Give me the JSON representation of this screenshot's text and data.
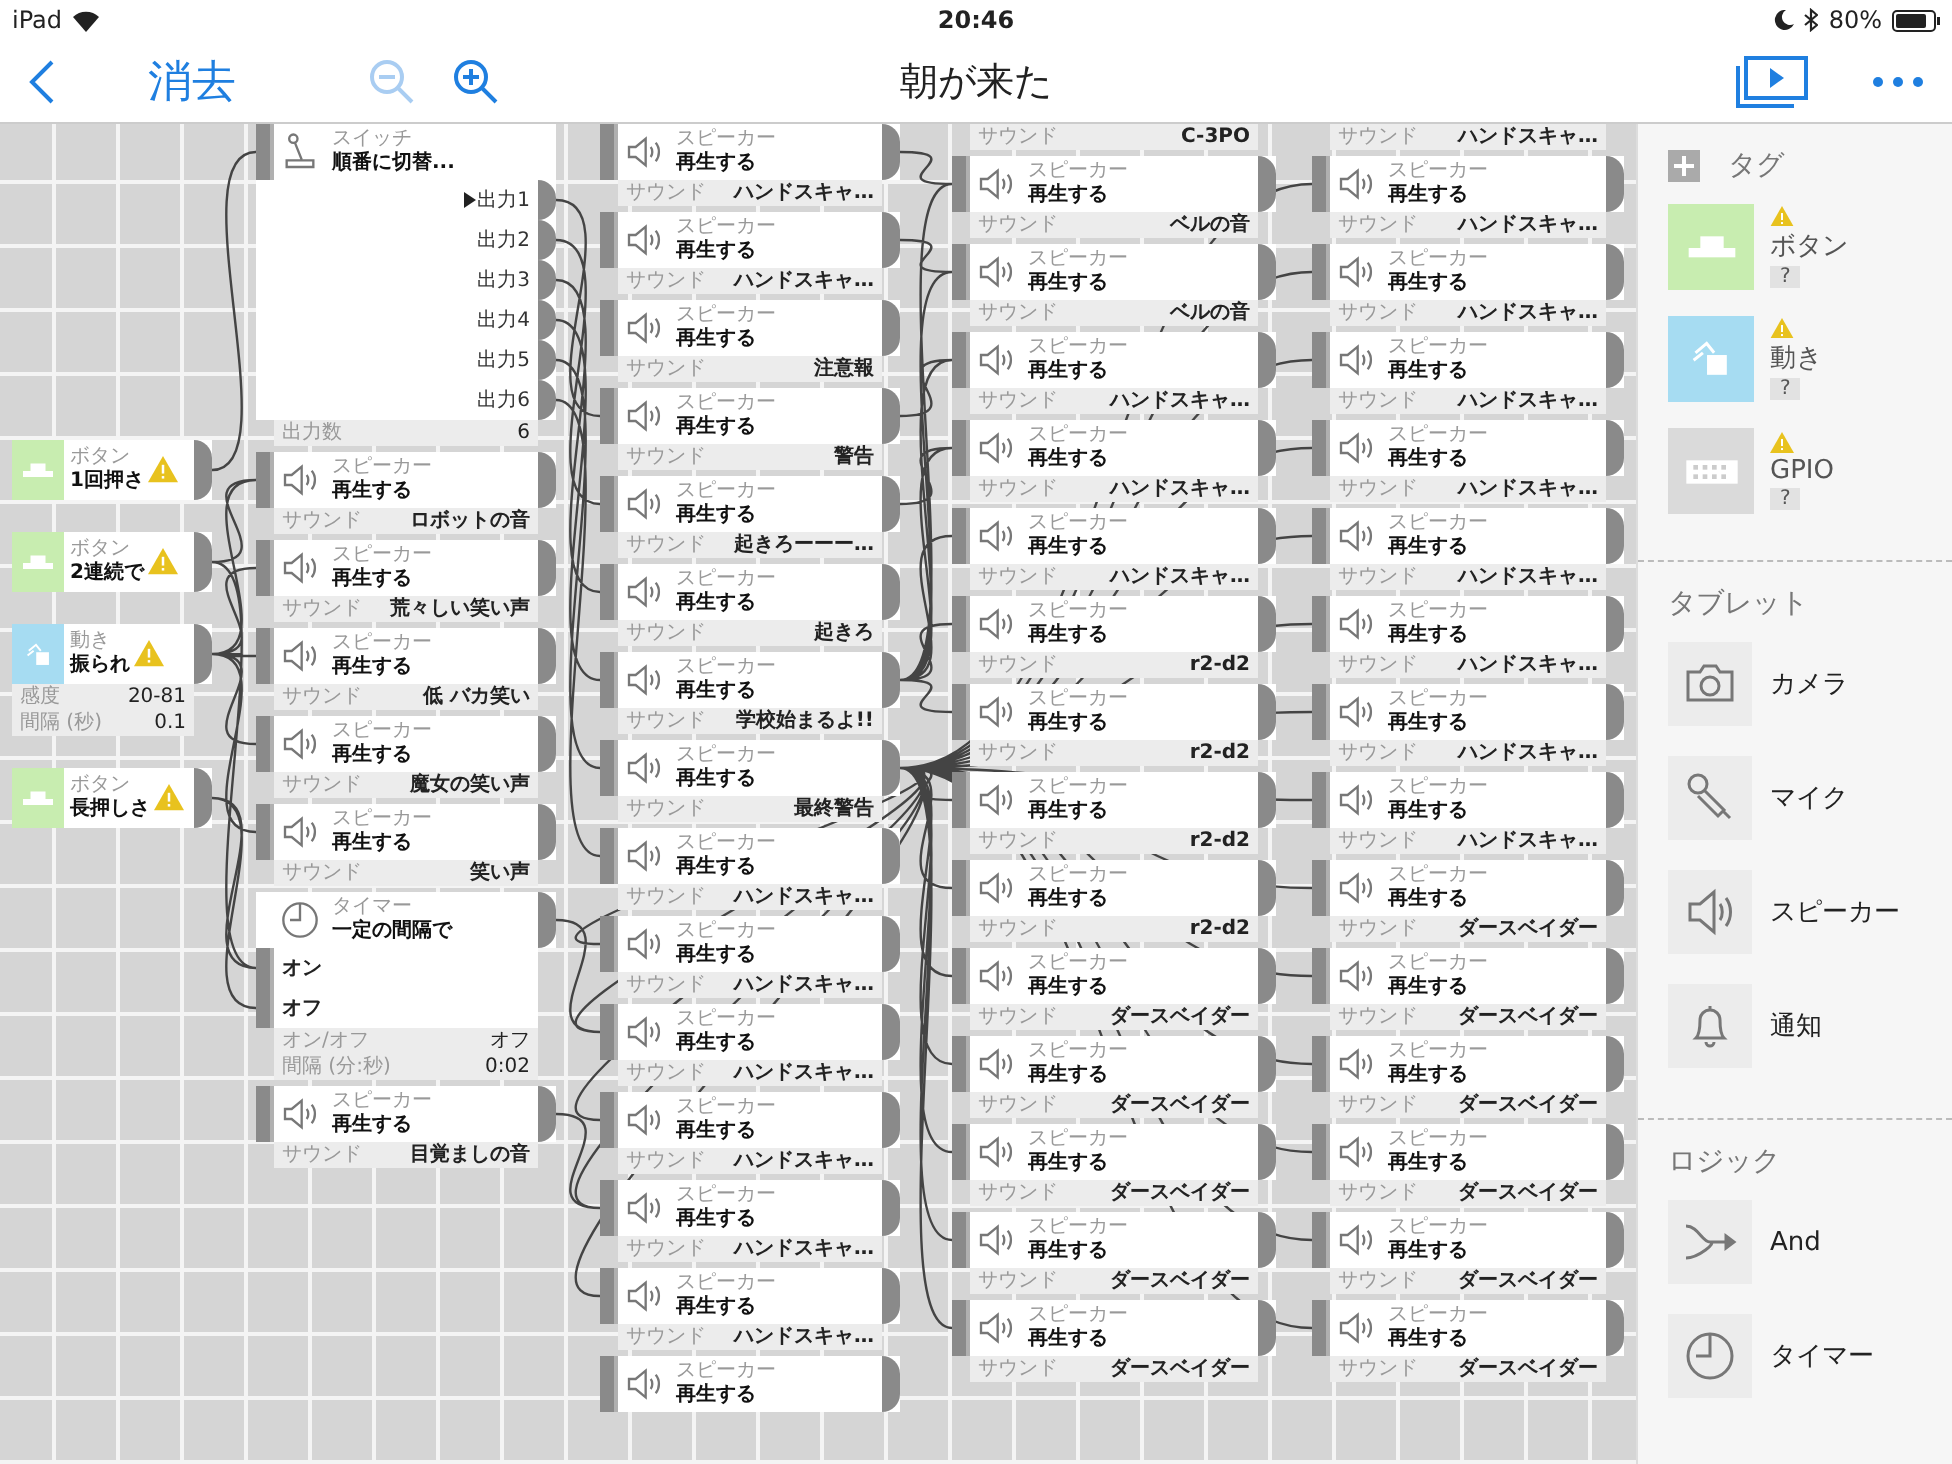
{
  "status_bar": {
    "device": "iPad",
    "time": "20:46",
    "battery": "80%"
  },
  "toolbar": {
    "clear": "消去",
    "title": "朝が来た",
    "zoom_out": {
      "disabled": true
    },
    "zoom_in": {
      "disabled": false
    }
  },
  "canvas": {
    "tag_nodes": [
      {
        "kind": "button",
        "color": "#c8edb0",
        "label": "ボタン",
        "title": "1回押さ",
        "warning": true
      },
      {
        "kind": "button",
        "color": "#c8edb0",
        "label": "ボタン",
        "title": "2連続で",
        "warning": true
      },
      {
        "kind": "motion",
        "color": "#a6dcf2",
        "label": "動き",
        "title": "振られ",
        "warning": true,
        "settings": [
          {
            "name": "感度",
            "value": "20-81"
          },
          {
            "name": "間隔 (秒)",
            "value": "0.1"
          }
        ]
      },
      {
        "kind": "button",
        "color": "#c8edb0",
        "label": "ボタン",
        "title": "長押しさ",
        "warning": true
      }
    ],
    "node_columns": [
      {
        "nodes": [
          {
            "kind": "switch",
            "label": "スイッチ",
            "title": "順番に切替...",
            "outputs": [
              {
                "label": "出力1",
                "selected": true
              },
              {
                "label": "出力2",
                "selected": false
              },
              {
                "label": "出力3",
                "selected": false
              },
              {
                "label": "出力4",
                "selected": false
              },
              {
                "label": "出力5",
                "selected": false
              },
              {
                "label": "出力6",
                "selected": false
              }
            ],
            "footer": [
              {
                "name": "出力数",
                "value": "6"
              }
            ]
          },
          {
            "kind": "speaker",
            "label": "スピーカー",
            "action": "再生する",
            "sound_label": "サウンド",
            "sound": "ロボットの音"
          },
          {
            "kind": "speaker",
            "label": "スピーカー",
            "action": "再生する",
            "sound_label": "サウンド",
            "sound": "荒々しい笑い声"
          },
          {
            "kind": "speaker",
            "label": "スピーカー",
            "action": "再生する",
            "sound_label": "サウンド",
            "sound": "低 バカ笑い"
          },
          {
            "kind": "speaker",
            "label": "スピーカー",
            "action": "再生する",
            "sound_label": "サウンド",
            "sound": "魔女の笑い声"
          },
          {
            "kind": "speaker",
            "label": "スピーカー",
            "action": "再生する",
            "sound_label": "サウンド",
            "sound": "笑い声"
          },
          {
            "kind": "timer",
            "label": "タイマー",
            "title": "一定の間隔で",
            "inputs": [
              "オン",
              "オフ"
            ],
            "footer": [
              {
                "name": "オン/オフ",
                "value": "オフ"
              },
              {
                "name": "間隔 (分:秒)",
                "value": "0:02"
              }
            ]
          },
          {
            "kind": "speaker",
            "label": "スピーカー",
            "action": "再生する",
            "sound_label": "サウンド",
            "sound": "目覚ましの音"
          }
        ]
      },
      {
        "nodes": [
          {
            "kind": "speaker",
            "label": "スピーカー",
            "action": "再生する",
            "sound_label": "サウンド",
            "sound": "ハンドスキャ…"
          },
          {
            "kind": "speaker",
            "label": "スピーカー",
            "action": "再生する",
            "sound_label": "サウンド",
            "sound": "ハンドスキャ…"
          },
          {
            "kind": "speaker",
            "label": "スピーカー",
            "action": "再生する",
            "sound_label": "サウンド",
            "sound": "注意報"
          },
          {
            "kind": "speaker",
            "label": "スピーカー",
            "action": "再生する",
            "sound_label": "サウンド",
            "sound": "警告"
          },
          {
            "kind": "speaker",
            "label": "スピーカー",
            "action": "再生する",
            "sound_label": "サウンド",
            "sound": "起きろーーー…"
          },
          {
            "kind": "speaker",
            "label": "スピーカー",
            "action": "再生する",
            "sound_label": "サウンド",
            "sound": "起きろ"
          },
          {
            "kind": "speaker",
            "label": "スピーカー",
            "action": "再生する",
            "sound_label": "サウンド",
            "sound": "学校始まるよ!!"
          },
          {
            "kind": "speaker",
            "label": "スピーカー",
            "action": "再生する",
            "sound_label": "サウンド",
            "sound": "最終警告"
          },
          {
            "kind": "speaker",
            "label": "スピーカー",
            "action": "再生する",
            "sound_label": "サウンド",
            "sound": "ハンドスキャ…"
          },
          {
            "kind": "speaker",
            "label": "スピーカー",
            "action": "再生する",
            "sound_label": "サウンド",
            "sound": "ハンドスキャ…"
          },
          {
            "kind": "speaker",
            "label": "スピーカー",
            "action": "再生する",
            "sound_label": "サウンド",
            "sound": "ハンドスキャ…"
          },
          {
            "kind": "speaker",
            "label": "スピーカー",
            "action": "再生する",
            "sound_label": "サウンド",
            "sound": "ハンドスキャ…"
          },
          {
            "kind": "speaker",
            "label": "スピーカー",
            "action": "再生する",
            "sound_label": "サウンド",
            "sound": "ハンドスキャ…"
          },
          {
            "kind": "speaker",
            "label": "スピーカー",
            "action": "再生する",
            "sound_label": "サウンド",
            "sound": "ハンドスキャ…"
          },
          {
            "kind": "speaker",
            "label": "スピーカー",
            "action": "再生する"
          }
        ]
      },
      {
        "nodes": [
          {
            "kind": "sound-only",
            "sound_label": "サウンド",
            "sound": "C-3PO"
          },
          {
            "kind": "speaker",
            "label": "スピーカー",
            "action": "再生する",
            "sound_label": "サウンド",
            "sound": "ベルの音"
          },
          {
            "kind": "speaker",
            "label": "スピーカー",
            "action": "再生する",
            "sound_label": "サウンド",
            "sound": "ベルの音"
          },
          {
            "kind": "speaker",
            "label": "スピーカー",
            "action": "再生する",
            "sound_label": "サウンド",
            "sound": "ハンドスキャ…"
          },
          {
            "kind": "speaker",
            "label": "スピーカー",
            "action": "再生する",
            "sound_label": "サウンド",
            "sound": "ハンドスキャ…"
          },
          {
            "kind": "speaker",
            "label": "スピーカー",
            "action": "再生する",
            "sound_label": "サウンド",
            "sound": "ハンドスキャ…"
          },
          {
            "kind": "speaker",
            "label": "スピーカー",
            "action": "再生する",
            "sound_label": "サウンド",
            "sound": "r2-d2"
          },
          {
            "kind": "speaker",
            "label": "スピーカー",
            "action": "再生する",
            "sound_label": "サウンド",
            "sound": "r2-d2"
          },
          {
            "kind": "speaker",
            "label": "スピーカー",
            "action": "再生する",
            "sound_label": "サウンド",
            "sound": "r2-d2"
          },
          {
            "kind": "speaker",
            "label": "スピーカー",
            "action": "再生する",
            "sound_label": "サウンド",
            "sound": "r2-d2"
          },
          {
            "kind": "speaker",
            "label": "スピーカー",
            "action": "再生する",
            "sound_label": "サウンド",
            "sound": "ダースベイダー"
          },
          {
            "kind": "speaker",
            "label": "スピーカー",
            "action": "再生する",
            "sound_label": "サウンド",
            "sound": "ダースベイダー"
          },
          {
            "kind": "speaker",
            "label": "スピーカー",
            "action": "再生する",
            "sound_label": "サウンド",
            "sound": "ダースベイダー"
          },
          {
            "kind": "speaker",
            "label": "スピーカー",
            "action": "再生する",
            "sound_label": "サウンド",
            "sound": "ダースベイダー"
          },
          {
            "kind": "speaker",
            "label": "スピーカー",
            "action": "再生する",
            "sound_label": "サウンド",
            "sound": "ダースベイダー"
          }
        ]
      },
      {
        "nodes": [
          {
            "kind": "sound-only",
            "sound_label": "サウンド",
            "sound": "ハンドスキャ…"
          },
          {
            "kind": "speaker",
            "label": "スピーカー",
            "action": "再生する",
            "sound_label": "サウンド",
            "sound": "ハンドスキャ…"
          },
          {
            "kind": "speaker",
            "label": "スピーカー",
            "action": "再生する",
            "sound_label": "サウンド",
            "sound": "ハンドスキャ…"
          },
          {
            "kind": "speaker",
            "label": "スピーカー",
            "action": "再生する",
            "sound_label": "サウンド",
            "sound": "ハンドスキャ…"
          },
          {
            "kind": "speaker",
            "label": "スピーカー",
            "action": "再生する",
            "sound_label": "サウンド",
            "sound": "ハンドスキャ…"
          },
          {
            "kind": "speaker",
            "label": "スピーカー",
            "action": "再生する",
            "sound_label": "サウンド",
            "sound": "ハンドスキャ…"
          },
          {
            "kind": "speaker",
            "label": "スピーカー",
            "action": "再生する",
            "sound_label": "サウンド",
            "sound": "ハンドスキャ…"
          },
          {
            "kind": "speaker",
            "label": "スピーカー",
            "action": "再生する",
            "sound_label": "サウンド",
            "sound": "ハンドスキャ…"
          },
          {
            "kind": "speaker",
            "label": "スピーカー",
            "action": "再生する",
            "sound_label": "サウンド",
            "sound": "ハンドスキャ…"
          },
          {
            "kind": "speaker",
            "label": "スピーカー",
            "action": "再生する",
            "sound_label": "サウンド",
            "sound": "ダースベイダー"
          },
          {
            "kind": "speaker",
            "label": "スピーカー",
            "action": "再生する",
            "sound_label": "サウンド",
            "sound": "ダースベイダー"
          },
          {
            "kind": "speaker",
            "label": "スピーカー",
            "action": "再生する",
            "sound_label": "サウンド",
            "sound": "ダースベイダー"
          },
          {
            "kind": "speaker",
            "label": "スピーカー",
            "action": "再生する",
            "sound_label": "サウンド",
            "sound": "ダースベイダー"
          },
          {
            "kind": "speaker",
            "label": "スピーカー",
            "action": "再生する",
            "sound_label": "サウンド",
            "sound": "ダースベイダー"
          },
          {
            "kind": "speaker",
            "label": "スピーカー",
            "action": "再生する",
            "sound_label": "サウンド",
            "sound": "ダースベイダー"
          }
        ]
      }
    ]
  },
  "sidebar": {
    "sections": [
      {
        "kind": "tags",
        "title": "タグ",
        "items": [
          {
            "kind": "button",
            "color": "#c8edb0",
            "name": "ボタン",
            "badge": "?",
            "warning": true
          },
          {
            "kind": "motion",
            "color": "#a6dcf2",
            "name": "動き",
            "badge": "?",
            "warning": true
          },
          {
            "kind": "gpio",
            "color": "#dadada",
            "name": "GPIO",
            "badge": "?",
            "warning": true
          }
        ]
      },
      {
        "kind": "palette",
        "title": "タブレット",
        "items": [
          {
            "kind": "camera",
            "name": "カメラ"
          },
          {
            "kind": "mic",
            "name": "マイク"
          },
          {
            "kind": "speaker",
            "name": "スピーカー"
          },
          {
            "kind": "bell",
            "name": "通知"
          }
        ]
      },
      {
        "kind": "palette",
        "title": "ロジック",
        "items": [
          {
            "kind": "and",
            "name": "And"
          },
          {
            "kind": "timer",
            "name": "タイマー"
          }
        ]
      }
    ]
  }
}
